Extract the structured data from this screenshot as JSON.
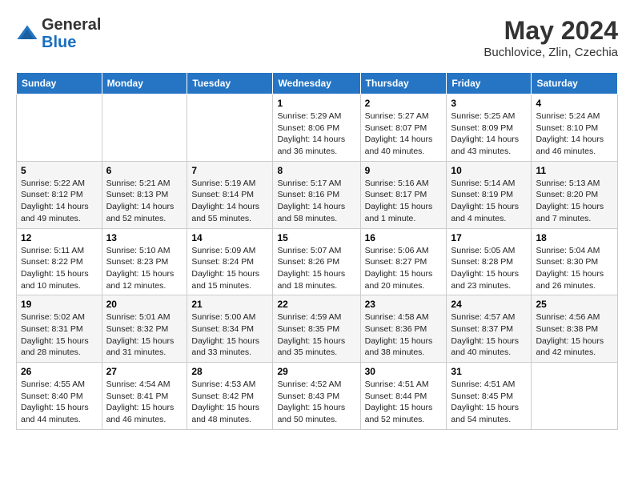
{
  "header": {
    "logo_general": "General",
    "logo_blue": "Blue",
    "month_year": "May 2024",
    "location": "Buchlovice, Zlin, Czechia"
  },
  "days_of_week": [
    "Sunday",
    "Monday",
    "Tuesday",
    "Wednesday",
    "Thursday",
    "Friday",
    "Saturday"
  ],
  "weeks": [
    [
      {
        "day": "",
        "info": ""
      },
      {
        "day": "",
        "info": ""
      },
      {
        "day": "",
        "info": ""
      },
      {
        "day": "1",
        "info": "Sunrise: 5:29 AM\nSunset: 8:06 PM\nDaylight: 14 hours and 36 minutes."
      },
      {
        "day": "2",
        "info": "Sunrise: 5:27 AM\nSunset: 8:07 PM\nDaylight: 14 hours and 40 minutes."
      },
      {
        "day": "3",
        "info": "Sunrise: 5:25 AM\nSunset: 8:09 PM\nDaylight: 14 hours and 43 minutes."
      },
      {
        "day": "4",
        "info": "Sunrise: 5:24 AM\nSunset: 8:10 PM\nDaylight: 14 hours and 46 minutes."
      }
    ],
    [
      {
        "day": "5",
        "info": "Sunrise: 5:22 AM\nSunset: 8:12 PM\nDaylight: 14 hours and 49 minutes."
      },
      {
        "day": "6",
        "info": "Sunrise: 5:21 AM\nSunset: 8:13 PM\nDaylight: 14 hours and 52 minutes."
      },
      {
        "day": "7",
        "info": "Sunrise: 5:19 AM\nSunset: 8:14 PM\nDaylight: 14 hours and 55 minutes."
      },
      {
        "day": "8",
        "info": "Sunrise: 5:17 AM\nSunset: 8:16 PM\nDaylight: 14 hours and 58 minutes."
      },
      {
        "day": "9",
        "info": "Sunrise: 5:16 AM\nSunset: 8:17 PM\nDaylight: 15 hours and 1 minute."
      },
      {
        "day": "10",
        "info": "Sunrise: 5:14 AM\nSunset: 8:19 PM\nDaylight: 15 hours and 4 minutes."
      },
      {
        "day": "11",
        "info": "Sunrise: 5:13 AM\nSunset: 8:20 PM\nDaylight: 15 hours and 7 minutes."
      }
    ],
    [
      {
        "day": "12",
        "info": "Sunrise: 5:11 AM\nSunset: 8:22 PM\nDaylight: 15 hours and 10 minutes."
      },
      {
        "day": "13",
        "info": "Sunrise: 5:10 AM\nSunset: 8:23 PM\nDaylight: 15 hours and 12 minutes."
      },
      {
        "day": "14",
        "info": "Sunrise: 5:09 AM\nSunset: 8:24 PM\nDaylight: 15 hours and 15 minutes."
      },
      {
        "day": "15",
        "info": "Sunrise: 5:07 AM\nSunset: 8:26 PM\nDaylight: 15 hours and 18 minutes."
      },
      {
        "day": "16",
        "info": "Sunrise: 5:06 AM\nSunset: 8:27 PM\nDaylight: 15 hours and 20 minutes."
      },
      {
        "day": "17",
        "info": "Sunrise: 5:05 AM\nSunset: 8:28 PM\nDaylight: 15 hours and 23 minutes."
      },
      {
        "day": "18",
        "info": "Sunrise: 5:04 AM\nSunset: 8:30 PM\nDaylight: 15 hours and 26 minutes."
      }
    ],
    [
      {
        "day": "19",
        "info": "Sunrise: 5:02 AM\nSunset: 8:31 PM\nDaylight: 15 hours and 28 minutes."
      },
      {
        "day": "20",
        "info": "Sunrise: 5:01 AM\nSunset: 8:32 PM\nDaylight: 15 hours and 31 minutes."
      },
      {
        "day": "21",
        "info": "Sunrise: 5:00 AM\nSunset: 8:34 PM\nDaylight: 15 hours and 33 minutes."
      },
      {
        "day": "22",
        "info": "Sunrise: 4:59 AM\nSunset: 8:35 PM\nDaylight: 15 hours and 35 minutes."
      },
      {
        "day": "23",
        "info": "Sunrise: 4:58 AM\nSunset: 8:36 PM\nDaylight: 15 hours and 38 minutes."
      },
      {
        "day": "24",
        "info": "Sunrise: 4:57 AM\nSunset: 8:37 PM\nDaylight: 15 hours and 40 minutes."
      },
      {
        "day": "25",
        "info": "Sunrise: 4:56 AM\nSunset: 8:38 PM\nDaylight: 15 hours and 42 minutes."
      }
    ],
    [
      {
        "day": "26",
        "info": "Sunrise: 4:55 AM\nSunset: 8:40 PM\nDaylight: 15 hours and 44 minutes."
      },
      {
        "day": "27",
        "info": "Sunrise: 4:54 AM\nSunset: 8:41 PM\nDaylight: 15 hours and 46 minutes."
      },
      {
        "day": "28",
        "info": "Sunrise: 4:53 AM\nSunset: 8:42 PM\nDaylight: 15 hours and 48 minutes."
      },
      {
        "day": "29",
        "info": "Sunrise: 4:52 AM\nSunset: 8:43 PM\nDaylight: 15 hours and 50 minutes."
      },
      {
        "day": "30",
        "info": "Sunrise: 4:51 AM\nSunset: 8:44 PM\nDaylight: 15 hours and 52 minutes."
      },
      {
        "day": "31",
        "info": "Sunrise: 4:51 AM\nSunset: 8:45 PM\nDaylight: 15 hours and 54 minutes."
      },
      {
        "day": "",
        "info": ""
      }
    ]
  ]
}
